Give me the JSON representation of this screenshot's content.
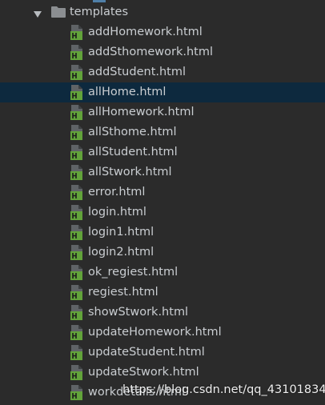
{
  "folder": {
    "name": "templates",
    "icon": "folder-icon",
    "expanded": true
  },
  "files": [
    {
      "name": "addHomework.html",
      "icon": "html-file-icon"
    },
    {
      "name": "addSthomework.html",
      "icon": "html-file-icon"
    },
    {
      "name": "addStudent.html",
      "icon": "html-file-icon"
    },
    {
      "name": "allHome.html",
      "icon": "html-file-icon",
      "selected": true
    },
    {
      "name": "allHomework.html",
      "icon": "html-file-icon"
    },
    {
      "name": "allSthome.html",
      "icon": "html-file-icon"
    },
    {
      "name": "allStudent.html",
      "icon": "html-file-icon"
    },
    {
      "name": "allStwork.html",
      "icon": "html-file-icon"
    },
    {
      "name": "error.html",
      "icon": "html-file-icon"
    },
    {
      "name": "login.html",
      "icon": "html-file-icon"
    },
    {
      "name": "login1.html",
      "icon": "html-file-icon"
    },
    {
      "name": "login2.html",
      "icon": "html-file-icon"
    },
    {
      "name": "ok_regiest.html",
      "icon": "html-file-icon"
    },
    {
      "name": "regiest.html",
      "icon": "html-file-icon"
    },
    {
      "name": "showStwork.html",
      "icon": "html-file-icon"
    },
    {
      "name": "updateHomework.html",
      "icon": "html-file-icon"
    },
    {
      "name": "updateStudent.html",
      "icon": "html-file-icon"
    },
    {
      "name": "updateStwork.html",
      "icon": "html-file-icon"
    },
    {
      "name": "workdetails.html",
      "icon": "html-file-icon"
    }
  ],
  "watermark": "https://blog.csdn.net/qq_43101834",
  "colors": {
    "background": "#2b2b2b",
    "selection": "#0d293e",
    "text": "#c9cdd1",
    "folder": "#8b8e91",
    "html_icon_green": "#62a33a"
  }
}
